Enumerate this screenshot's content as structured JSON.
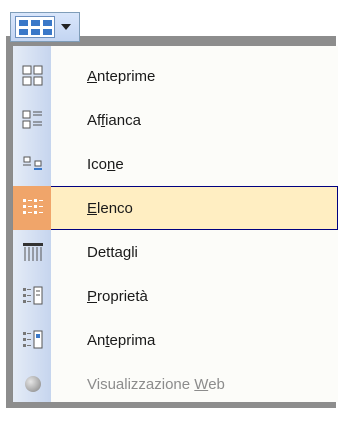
{
  "menu": {
    "items": [
      {
        "key": "anteprime",
        "pre": "",
        "mnem": "A",
        "post": "nteprime",
        "icon": "thumbnails-icon",
        "disabled": false,
        "selected": false
      },
      {
        "key": "affianca",
        "pre": "Af",
        "mnem": "f",
        "post": "ianca",
        "icon": "tiles-icon",
        "disabled": false,
        "selected": false
      },
      {
        "key": "icone",
        "pre": "Ico",
        "mnem": "n",
        "post": "e",
        "icon": "icons-icon",
        "disabled": false,
        "selected": false
      },
      {
        "key": "elenco",
        "pre": "",
        "mnem": "E",
        "post": "lenco",
        "icon": "list-icon",
        "disabled": false,
        "selected": true
      },
      {
        "key": "dettagli",
        "pre": "Detta",
        "mnem": "g",
        "post": "li",
        "icon": "details-icon",
        "disabled": false,
        "selected": false
      },
      {
        "key": "proprieta",
        "pre": "",
        "mnem": "P",
        "post": "roprietà",
        "icon": "properties-icon",
        "disabled": false,
        "selected": false
      },
      {
        "key": "anteprima",
        "pre": "An",
        "mnem": "t",
        "post": "eprima",
        "icon": "preview-icon",
        "disabled": false,
        "selected": false
      },
      {
        "key": "web",
        "pre": "Visualizzazione ",
        "mnem": "W",
        "post": "eb",
        "icon": "web-view-icon",
        "disabled": true,
        "selected": false
      }
    ]
  },
  "colors": {
    "selected_bg": "#ffeec2",
    "selected_border": "#000080",
    "icon_col": "#c6d5ee"
  }
}
